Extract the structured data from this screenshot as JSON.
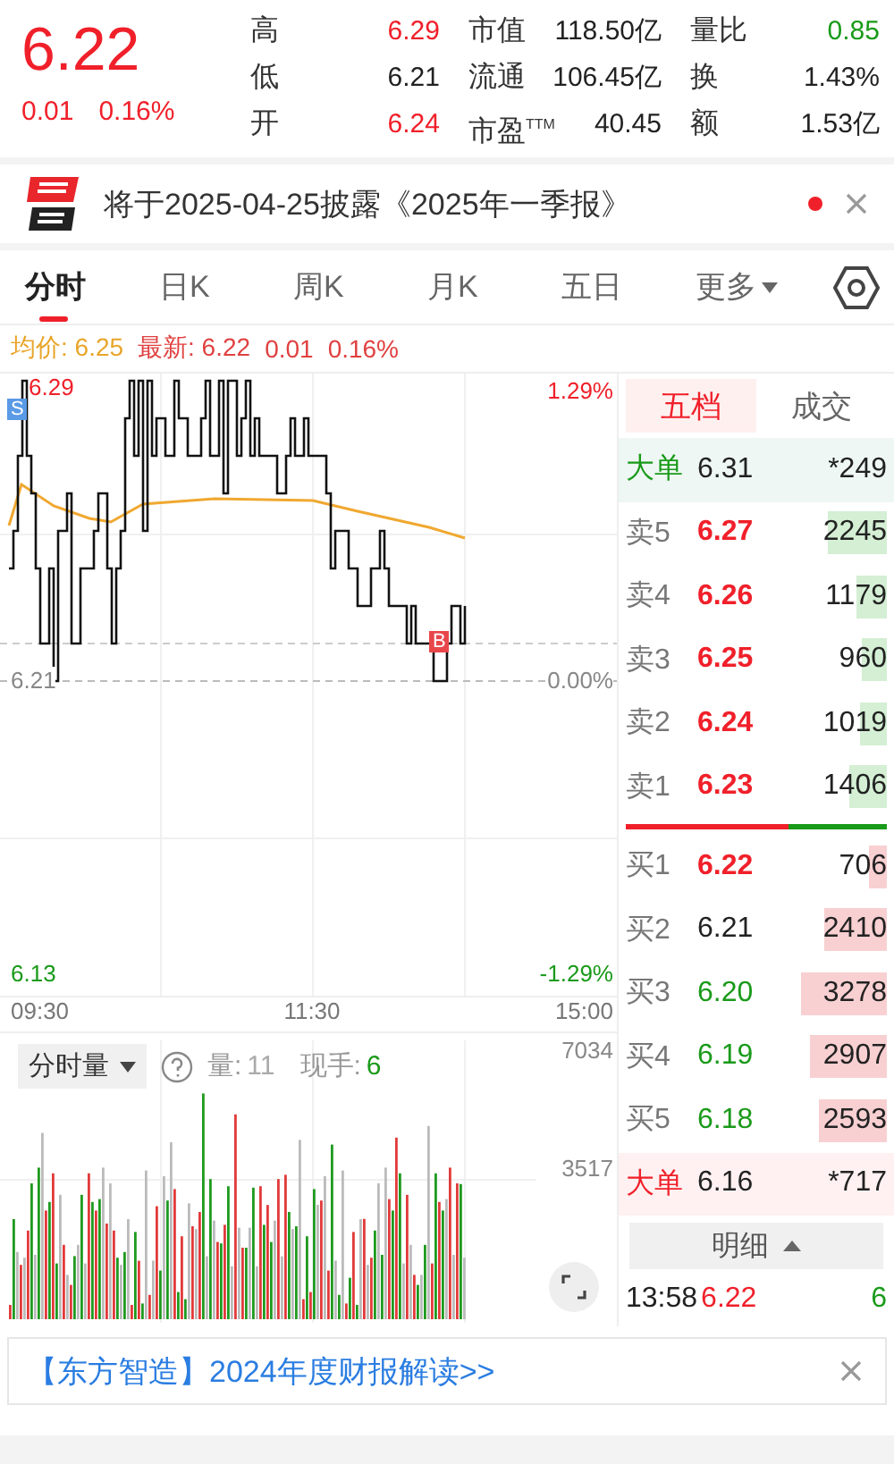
{
  "quote": {
    "price": "6.22",
    "change": "0.01",
    "change_pct": "0.16%",
    "color": "#f0202a"
  },
  "stats": [
    {
      "label": "高",
      "value": "6.29",
      "color": "#f0202a"
    },
    {
      "label": "市值",
      "value": "118.50亿",
      "color": "#222222"
    },
    {
      "label": "量比",
      "value": "0.85",
      "color": "#1a9a1a"
    },
    {
      "label": "低",
      "value": "6.21",
      "color": "#222222"
    },
    {
      "label": "流通",
      "value": "106.45亿",
      "color": "#222222"
    },
    {
      "label": "换",
      "value": "1.43%",
      "color": "#222222"
    },
    {
      "label": "开",
      "value": "6.24",
      "color": "#f0202a"
    },
    {
      "label": "市盈$^{TTM}$",
      "value": "40.45",
      "color": "#222222"
    },
    {
      "label": "额",
      "value": "1.53亿",
      "color": "#222222"
    }
  ],
  "notice": {
    "text": "将于2025-04-25披露《2025年一季报》",
    "unread": true
  },
  "tabs": [
    {
      "label": "分时",
      "selected": true,
      "kind": "tab"
    },
    {
      "label": "日K",
      "selected": false,
      "kind": "tab"
    },
    {
      "label": "周K",
      "selected": false,
      "kind": "tab"
    },
    {
      "label": "月K",
      "selected": false,
      "kind": "tab"
    },
    {
      "label": "五日",
      "selected": false,
      "kind": "tab"
    },
    {
      "label": "更多",
      "selected": false,
      "kind": "menu"
    }
  ],
  "info": {
    "avg": "均价: 6.25",
    "latest": "最新: 6.22",
    "change": "0.01",
    "change_pct": "0.16%"
  },
  "price_chart": {
    "high": "6.29",
    "high_pct": "1.29%",
    "base": "6.21",
    "base_pct": "0.00%",
    "low": "6.13",
    "low_pct": "-1.29%",
    "times": [
      "09:30",
      "11:30",
      "15:00"
    ],
    "markers": [
      {
        "label": "S",
        "color": "#5a9ae6"
      },
      {
        "label": "B",
        "color": "#e8464a"
      }
    ]
  },
  "volume": {
    "selector": "分时量",
    "volume_label": "量:",
    "volume": "11",
    "hand_label": "现手:",
    "hand": "6",
    "ymax": "7034",
    "ymid": "3517"
  },
  "book": {
    "tabs": [
      {
        "label": "五档",
        "selected": true
      },
      {
        "label": "成交",
        "selected": false
      }
    ],
    "rows": [
      {
        "kind": "bigsell",
        "label": "大单",
        "price": "6.31",
        "color": "#222222",
        "volume": "*249"
      },
      {
        "kind": "ask",
        "label": "卖5",
        "price": "6.27",
        "color": "#f0202a",
        "volume": "2245"
      },
      {
        "kind": "ask",
        "label": "卖4",
        "price": "6.26",
        "color": "#f0202a",
        "volume": "1179"
      },
      {
        "kind": "ask",
        "label": "卖3",
        "price": "6.25",
        "color": "#f0202a",
        "volume": "960"
      },
      {
        "kind": "ask",
        "label": "卖2",
        "price": "6.24",
        "color": "#f0202a",
        "volume": "1019"
      },
      {
        "kind": "ask",
        "label": "卖1",
        "price": "6.23",
        "color": "#f0202a",
        "volume": "1406"
      },
      {
        "kind": "bid",
        "label": "买1",
        "price": "6.22",
        "color": "#f0202a",
        "volume": "706"
      },
      {
        "kind": "bid",
        "label": "买2",
        "price": "6.21",
        "color": "#222222",
        "volume": "2410"
      },
      {
        "kind": "bid",
        "label": "买3",
        "price": "6.20",
        "color": "#1a9a1a",
        "volume": "3278"
      },
      {
        "kind": "bid",
        "label": "买4",
        "price": "6.19",
        "color": "#1a9a1a",
        "volume": "2907"
      },
      {
        "kind": "bid",
        "label": "买5",
        "price": "6.18",
        "color": "#1a9a1a",
        "volume": "2593"
      },
      {
        "kind": "bigbuy",
        "label": "大单",
        "price": "6.16",
        "color": "#222222",
        "volume": "*717"
      }
    ],
    "detail_button": "明细",
    "trades": [
      {
        "time": "13:58",
        "price": "6.22",
        "color": "#f0202a",
        "volume": "6",
        "kind": "sell"
      }
    ]
  },
  "banner": {
    "text": "【东方智造】2024年度财报解读>>"
  }
}
